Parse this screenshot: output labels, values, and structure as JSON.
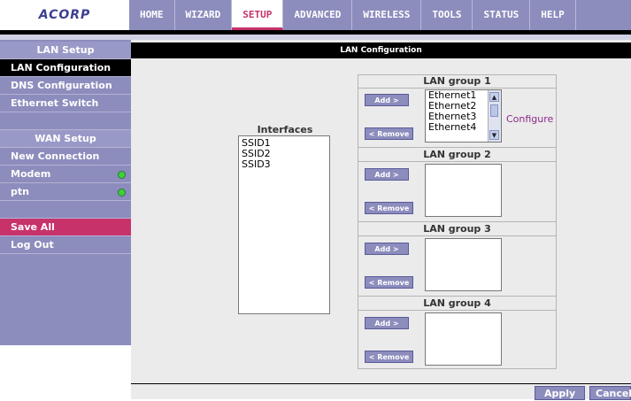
{
  "brand": {
    "logo_text": "ACORP"
  },
  "nav": [
    "HOME",
    "WIZARD",
    "SETUP",
    "ADVANCED",
    "WIRELESS",
    "TOOLS",
    "STATUS",
    "HELP"
  ],
  "nav_active": "SETUP",
  "sidebar": {
    "lan_header": "LAN Setup",
    "lan_items": [
      "LAN Configuration",
      "DNS Configuration",
      "Ethernet Switch"
    ],
    "wan_header": "WAN Setup",
    "wan_items": [
      "New Connection",
      "Modem",
      "ptn"
    ],
    "save_all": "Save All",
    "log_out": "Log Out"
  },
  "main": {
    "title": "LAN Configuration",
    "interfaces_label": "Interfaces",
    "interfaces": [
      "SSID1",
      "SSID2",
      "SSID3"
    ],
    "groups": [
      {
        "title": "LAN group 1",
        "members": [
          "Ethernet1",
          "Ethernet2",
          "Ethernet3",
          "Ethernet4"
        ]
      },
      {
        "title": "LAN group 2",
        "members": []
      },
      {
        "title": "LAN group 3",
        "members": []
      },
      {
        "title": "LAN group 4",
        "members": []
      }
    ],
    "add_label": "Add >",
    "remove_label": "< Remove",
    "configure_label": "Configure",
    "apply_label": "Apply",
    "cancel_label": "Cancel"
  },
  "colors": {
    "accent": "#c8326b",
    "nav": "#8c8cbd",
    "status_ok": "#3bd23b"
  },
  "icons": {
    "scroll_up": "up-arrow-icon",
    "scroll_down": "down-arrow-icon",
    "status": "status-dot-icon"
  }
}
